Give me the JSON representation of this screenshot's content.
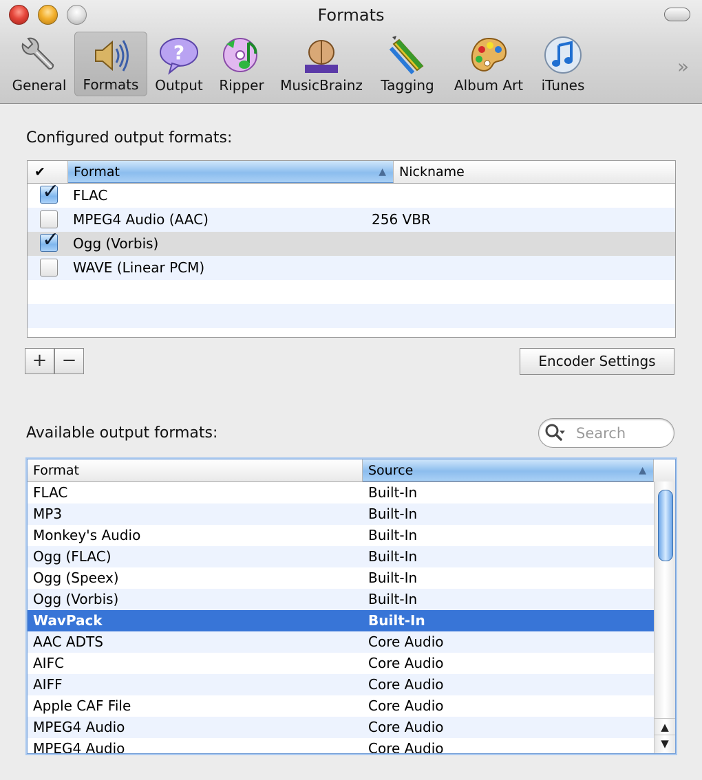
{
  "window": {
    "title": "Formats"
  },
  "toolbar": {
    "items": [
      {
        "label": "General",
        "icon": "wrench-icon"
      },
      {
        "label": "Formats",
        "icon": "speaker-icon",
        "selected": true
      },
      {
        "label": "Output",
        "icon": "question-bubble-icon"
      },
      {
        "label": "Ripper",
        "icon": "cd-note-icon"
      },
      {
        "label": "MusicBrainz",
        "icon": "musicbrainz-icon"
      },
      {
        "label": "Tagging",
        "icon": "crayons-icon"
      },
      {
        "label": "Album Art",
        "icon": "palette-icon"
      },
      {
        "label": "iTunes",
        "icon": "itunes-icon"
      }
    ],
    "musicbrainz_logo_text": "MusicBrainz",
    "overflow_glyph": "»"
  },
  "configured": {
    "label": "Configured output formats:",
    "columns": {
      "check": "✔",
      "format": "Format",
      "nickname": "Nickname"
    },
    "rows": [
      {
        "checked": true,
        "format": "FLAC",
        "nickname": ""
      },
      {
        "checked": false,
        "format": "MPEG4 Audio (AAC)",
        "nickname": "256 VBR"
      },
      {
        "checked": true,
        "format": "Ogg (Vorbis)",
        "nickname": ""
      },
      {
        "checked": false,
        "format": "WAVE (Linear PCM)",
        "nickname": ""
      }
    ],
    "add_label": "+",
    "remove_label": "−",
    "encoder_settings_label": "Encoder Settings"
  },
  "available": {
    "label": "Available output formats:",
    "search_placeholder": "Search",
    "columns": {
      "format": "Format",
      "source": "Source"
    },
    "rows": [
      {
        "format": "FLAC",
        "source": "Built-In"
      },
      {
        "format": "MP3",
        "source": "Built-In"
      },
      {
        "format": "Monkey's Audio",
        "source": "Built-In"
      },
      {
        "format": "Ogg (FLAC)",
        "source": "Built-In"
      },
      {
        "format": "Ogg (Speex)",
        "source": "Built-In"
      },
      {
        "format": "Ogg (Vorbis)",
        "source": "Built-In"
      },
      {
        "format": "WavPack",
        "source": "Built-In",
        "selected": true
      },
      {
        "format": "AAC ADTS",
        "source": "Core Audio"
      },
      {
        "format": "AIFC",
        "source": "Core Audio"
      },
      {
        "format": "AIFF",
        "source": "Core Audio"
      },
      {
        "format": "Apple CAF File",
        "source": "Core Audio"
      },
      {
        "format": "MPEG4 Audio",
        "source": "Core Audio"
      },
      {
        "format": "MPEG4 Audio",
        "source": "Core Audio"
      }
    ]
  },
  "colors": {
    "selection": "#3875d7",
    "sort_header": "#8cbdee",
    "alt_row": "#edf3fe",
    "highlight_row": "#dcdcdc"
  }
}
